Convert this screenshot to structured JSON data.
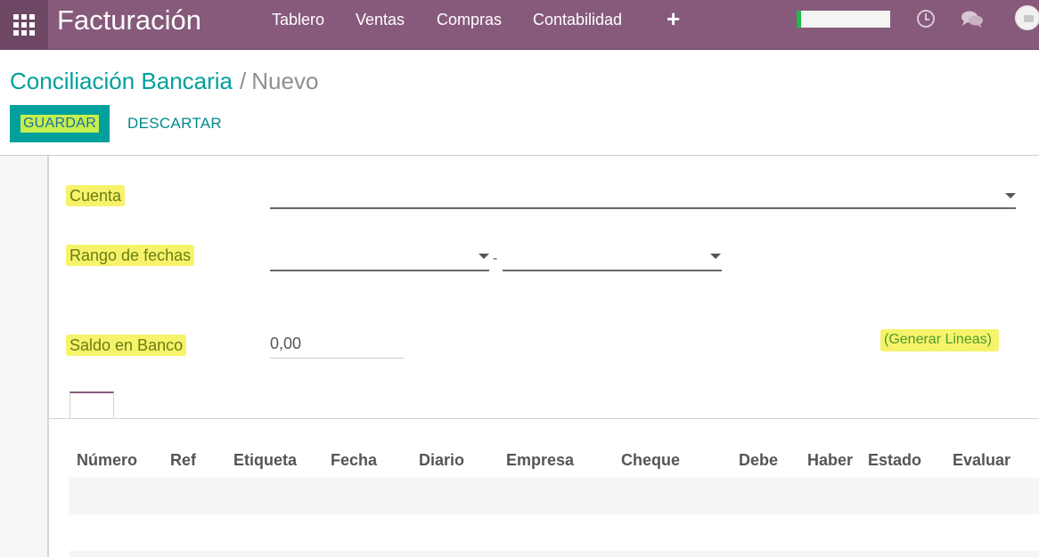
{
  "navbar": {
    "brand": "Facturación",
    "menu": [
      "Tablero",
      "Ventas",
      "Compras",
      "Contabilidad"
    ],
    "progress": 0.05,
    "colors": {
      "bar": "#875a7b",
      "apps": "#6e4764",
      "progress": "#21b94a"
    },
    "icons": [
      "apps-grid-icon",
      "plus-icon",
      "clock-icon",
      "chat-icon",
      "avatar"
    ]
  },
  "breadcrumb": {
    "parent": "Conciliación Bancaria",
    "separator": "/",
    "current": "Nuevo"
  },
  "buttons": {
    "save": "GUARDAR",
    "discard": "DESCARTAR"
  },
  "form": {
    "account_label": "Cuenta",
    "account_value": "",
    "date_range_label": "Rango de fechas",
    "date_from": "",
    "date_separator": "-",
    "date_to": "",
    "balance_label": "Saldo en Banco",
    "balance_value": "0,00",
    "generate_link": "(Generar Lineas)"
  },
  "table": {
    "columns": [
      "Número",
      "Ref",
      "Etiqueta",
      "Fecha",
      "Diario",
      "Empresa",
      "Cheque",
      "Debe",
      "Haber",
      "Estado",
      "Evaluar"
    ],
    "rows": []
  },
  "accent": "#00a09d",
  "highlight": "#f6f36b"
}
